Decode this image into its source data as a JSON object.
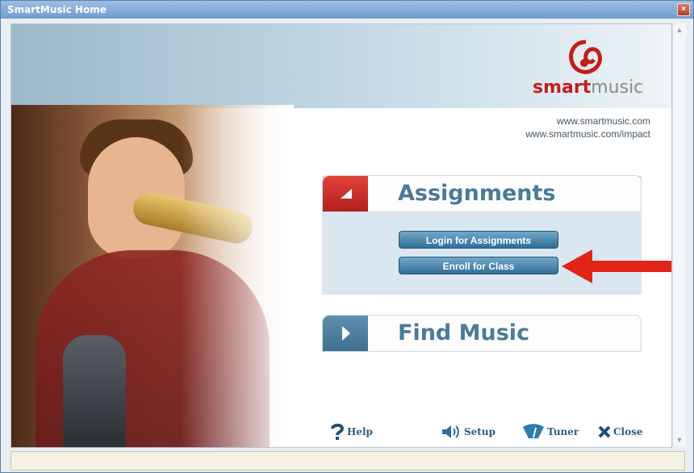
{
  "window": {
    "title": "SmartMusic Home",
    "close_glyph": "×"
  },
  "logo": {
    "brand_prefix": "smart",
    "brand_suffix": "music",
    "icon": "smartmusic-logo-icon",
    "accent_color": "#c21f1a"
  },
  "links": [
    "www.smartmusic.com",
    "www.smartmusic.com/impact"
  ],
  "assignments": {
    "title": "Assignments",
    "buttons": {
      "login": "Login for Assignments",
      "enroll": "Enroll for Class"
    }
  },
  "find_music": {
    "title": "Find Music"
  },
  "footer": {
    "help": {
      "label": "Help",
      "icon": "question-mark-icon"
    },
    "setup": {
      "label": "Setup",
      "icon": "speaker-icon"
    },
    "tuner": {
      "label": "Tuner",
      "icon": "tuner-icon"
    },
    "close": {
      "label": "Close",
      "icon": "x-icon"
    }
  },
  "annotation": {
    "icon": "red-arrow-icon",
    "color": "#e02418"
  }
}
